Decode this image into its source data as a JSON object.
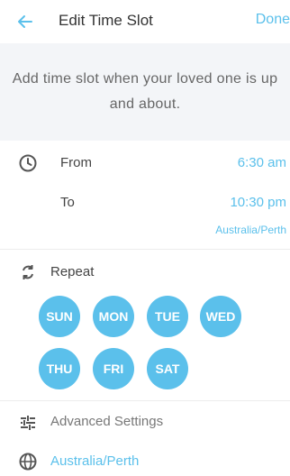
{
  "header": {
    "back_icon": "arrow-left-icon",
    "title": "Edit Time Slot",
    "done_label": "Done"
  },
  "banner": {
    "text": "Add time slot when your loved one is up and about."
  },
  "time": {
    "from_label": "From",
    "from_value": "6:30 am",
    "to_label": "To",
    "to_value": "10:30 pm",
    "timezone": "Australia/Perth"
  },
  "repeat": {
    "label": "Repeat",
    "days": [
      "SUN",
      "MON",
      "TUE",
      "WED",
      "THU",
      "FRI",
      "SAT"
    ]
  },
  "advanced": {
    "label": "Advanced Settings"
  },
  "timezone_setting": {
    "value": "Australia/Perth"
  },
  "colors": {
    "accent": "#5bc0eb",
    "banner_bg": "#f3f5f8",
    "text": "#333333"
  }
}
